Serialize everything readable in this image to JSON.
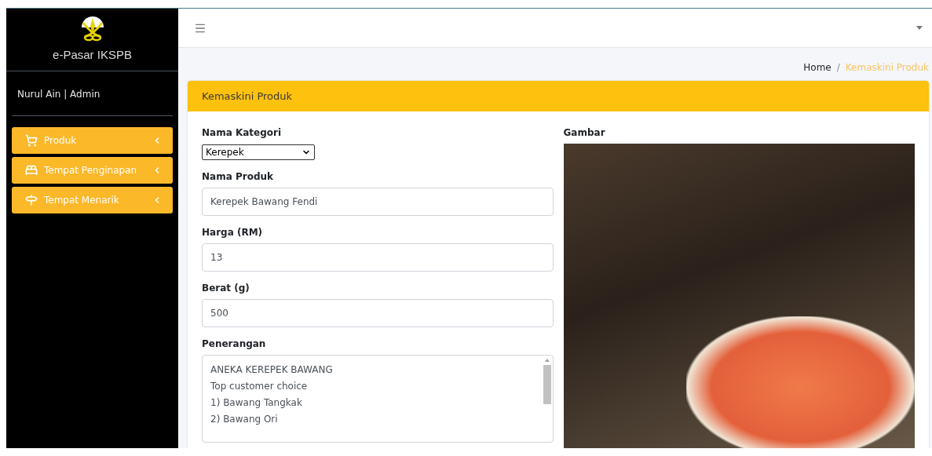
{
  "sidebar": {
    "brand": "e-Pasar IKSPB",
    "user": "Nurul Ain | Admin",
    "items": [
      {
        "kind": "cart",
        "label": "Produk",
        "expanded": false
      },
      {
        "kind": "bed",
        "label": "Tempat Penginapan",
        "expanded": false
      },
      {
        "kind": "signpost",
        "label": "Tempat Menarik",
        "expanded": false
      }
    ]
  },
  "breadcrumb_separator": "/",
  "breadcrumb": [
    {
      "label": "Home",
      "selected": false
    },
    {
      "label": "Kemaskini Produk",
      "selected": true
    }
  ],
  "card": {
    "title": "Kemaskini Produk",
    "fields": [
      {
        "kind": "select",
        "label": "Nama Kategori",
        "value": "Kerepek"
      },
      {
        "kind": "text",
        "label": "Nama Produk",
        "value": "Kerepek Bawang Fendi"
      },
      {
        "kind": "text",
        "label": "Harga (RM)",
        "value": "13"
      },
      {
        "kind": "text",
        "label": "Berat (g)",
        "value": "500"
      },
      {
        "kind": "textarea",
        "label": "Penerangan",
        "value": "ANEKA KEREPEK BAWANG\nTop customer choice\n1) Bawang Tangkak\n2) Bawang Ori"
      }
    ],
    "image_label": "Gambar"
  }
}
